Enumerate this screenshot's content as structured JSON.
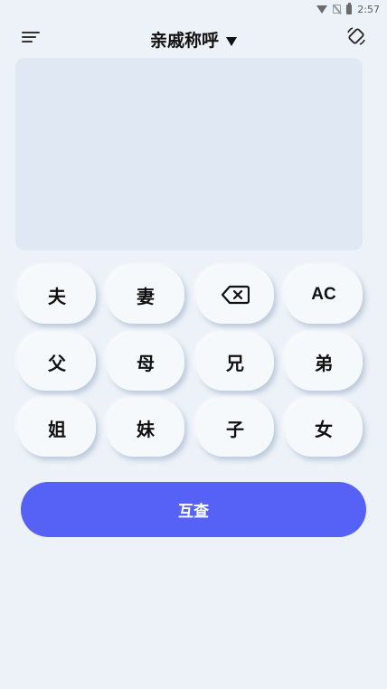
{
  "status_bar": {
    "time": "2:57"
  },
  "toolbar": {
    "title": "亲戚称呼"
  },
  "keypad": {
    "row1": [
      "夫",
      "妻",
      "",
      "AC"
    ],
    "row2": [
      "父",
      "母",
      "兄",
      "弟"
    ],
    "row3": [
      "姐",
      "妹",
      "子",
      "女"
    ]
  },
  "primary_action": {
    "label": "互查"
  },
  "colors": {
    "accent": "#5661f6",
    "background": "#edf2f8",
    "display": "#e0e9f3"
  }
}
